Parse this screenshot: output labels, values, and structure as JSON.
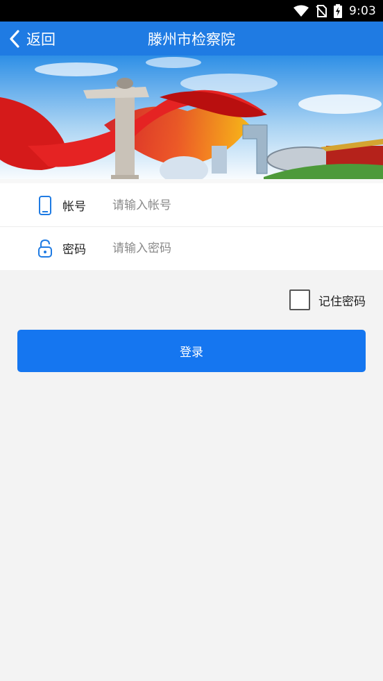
{
  "status_bar": {
    "time": "9:03"
  },
  "app_bar": {
    "back_label": "返回",
    "title": "滕州市检察院"
  },
  "form": {
    "account": {
      "label": "帐号",
      "placeholder": "请输入帐号"
    },
    "password": {
      "label": "密码",
      "placeholder": "请输入密码"
    }
  },
  "remember": {
    "label": "记住密码"
  },
  "login_button": {
    "label": "登录"
  },
  "colors": {
    "primary": "#1f7be3",
    "button": "#1576f0",
    "background": "#f3f3f3"
  }
}
